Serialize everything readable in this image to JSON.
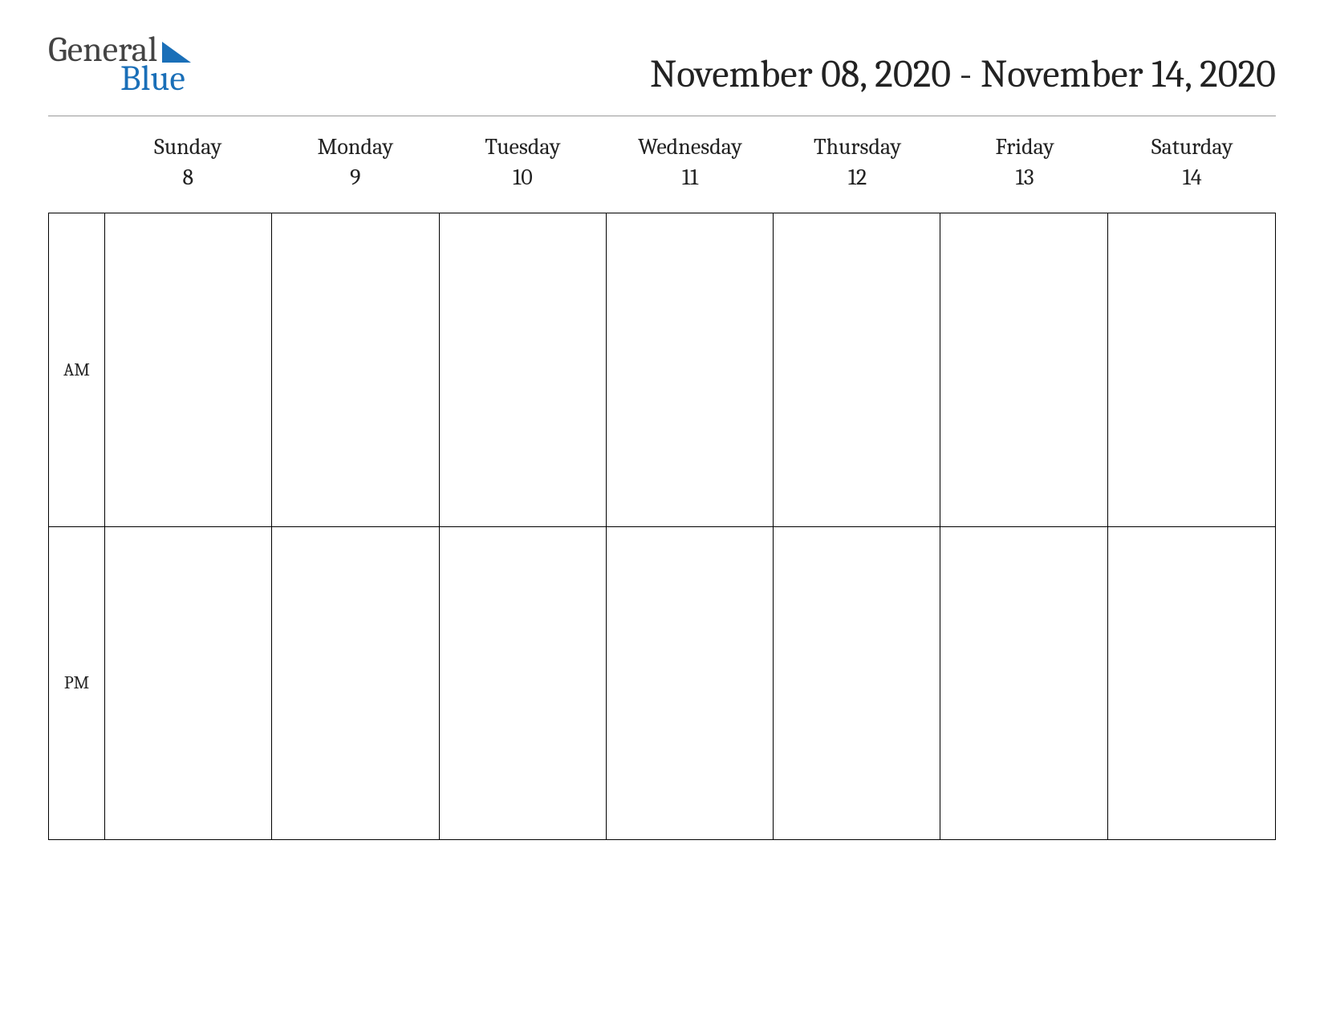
{
  "logo": {
    "word1": "General",
    "word2": "Blue"
  },
  "title": "November 08, 2020 - November 14, 2020",
  "periods": [
    "AM",
    "PM"
  ],
  "days": [
    {
      "name": "Sunday",
      "num": "8"
    },
    {
      "name": "Monday",
      "num": "9"
    },
    {
      "name": "Tuesday",
      "num": "10"
    },
    {
      "name": "Wednesday",
      "num": "11"
    },
    {
      "name": "Thursday",
      "num": "12"
    },
    {
      "name": "Friday",
      "num": "13"
    },
    {
      "name": "Saturday",
      "num": "14"
    }
  ]
}
